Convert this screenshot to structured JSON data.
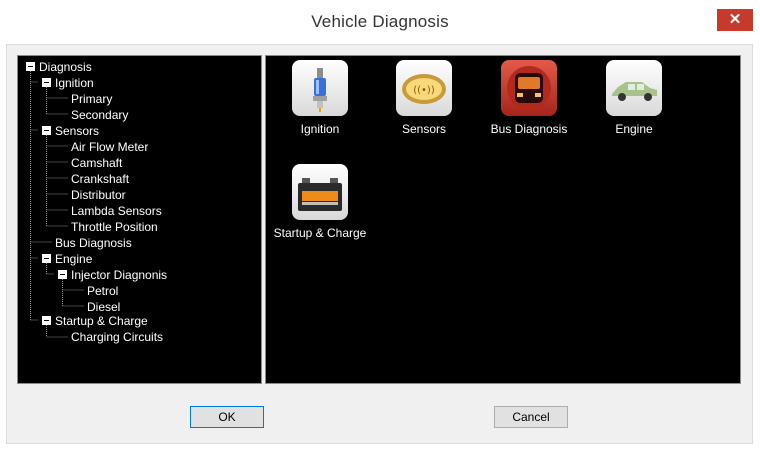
{
  "window": {
    "title": "Vehicle Diagnosis",
    "close_label": "✕"
  },
  "tree": {
    "root": "Diagnosis",
    "ignition": "Ignition",
    "primary": "Primary",
    "secondary": "Secondary",
    "sensors": "Sensors",
    "air_flow_meter": "Air Flow Meter",
    "camshaft": "Camshaft",
    "crankshaft": "Crankshaft",
    "distributor": "Distributor",
    "lambda_sensors": "Lambda Sensors",
    "throttle_position": "Throttle Position",
    "bus_diagnosis": "Bus Diagnosis",
    "engine": "Engine",
    "injector_diagnosis": "Injector Diagnonis",
    "petrol": "Petrol",
    "diesel": "Diesel",
    "startup_charge": "Startup & Charge",
    "charging_circuits": "Charging Circuits"
  },
  "tiles": {
    "ignition": {
      "label": "Ignition",
      "icon": "spark-plug-icon"
    },
    "sensors": {
      "label": "Sensors",
      "icon": "sensor-icon"
    },
    "bus_diagnosis": {
      "label": "Bus Diagnosis",
      "icon": "bus-icon"
    },
    "engine": {
      "label": "Engine",
      "icon": "car-icon"
    },
    "startup_charge": {
      "label": "Startup & Charge",
      "icon": "battery-icon"
    }
  },
  "buttons": {
    "ok": "OK",
    "cancel": "Cancel"
  },
  "colors": {
    "close": "#c7392b",
    "panel_bg": "#000000",
    "dialog_bg": "#f0f0f0"
  }
}
